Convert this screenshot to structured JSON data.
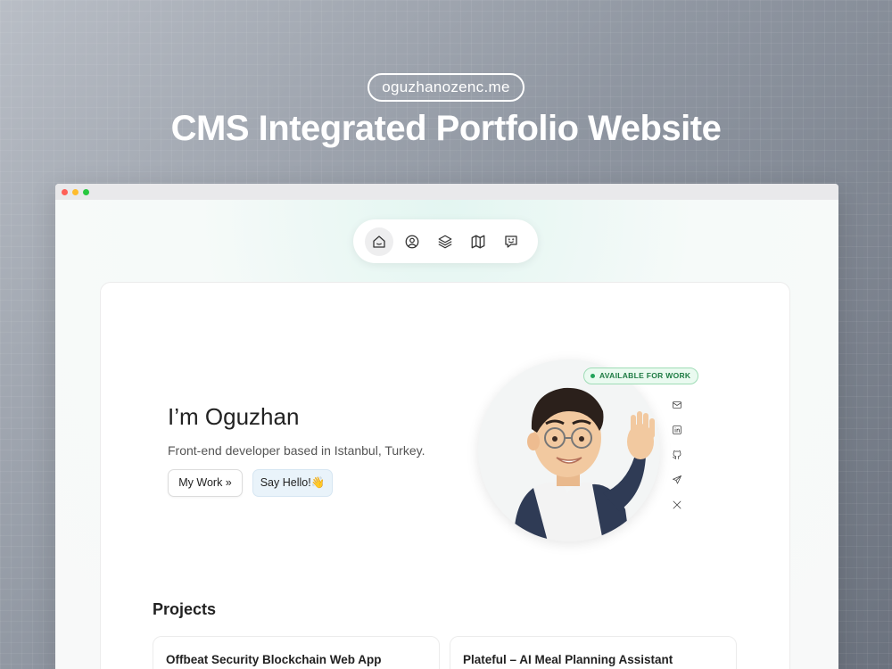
{
  "banner": {
    "domain": "oguzhanozenc.me",
    "headline": "CMS Integrated Portfolio Website"
  },
  "nav": {
    "items": [
      {
        "icon": "home-icon",
        "active": true
      },
      {
        "icon": "user-circle-icon",
        "active": false
      },
      {
        "icon": "layers-icon",
        "active": false
      },
      {
        "icon": "map-icon",
        "active": false
      },
      {
        "icon": "message-smile-icon",
        "active": false
      }
    ]
  },
  "hero": {
    "greeting": "I’m Oguzhan",
    "tagline": "Front-end developer based in Istanbul, Turkey.",
    "work_button": "My Work »",
    "hello_button": "Say Hello!👋",
    "status_badge": "AVAILABLE FOR WORK"
  },
  "socials": [
    "mail-icon",
    "linkedin-icon",
    "github-icon",
    "telegram-icon",
    "x-icon"
  ],
  "projects": {
    "title": "Projects",
    "items": [
      {
        "title": "Offbeat Security Blockchain Web App"
      },
      {
        "title": "Plateful – AI Meal Planning Assistant"
      }
    ]
  },
  "colors": {
    "accent_green": "#22a35a",
    "badge_bg": "#eafaf0",
    "hello_bg": "#e9f3fa"
  }
}
